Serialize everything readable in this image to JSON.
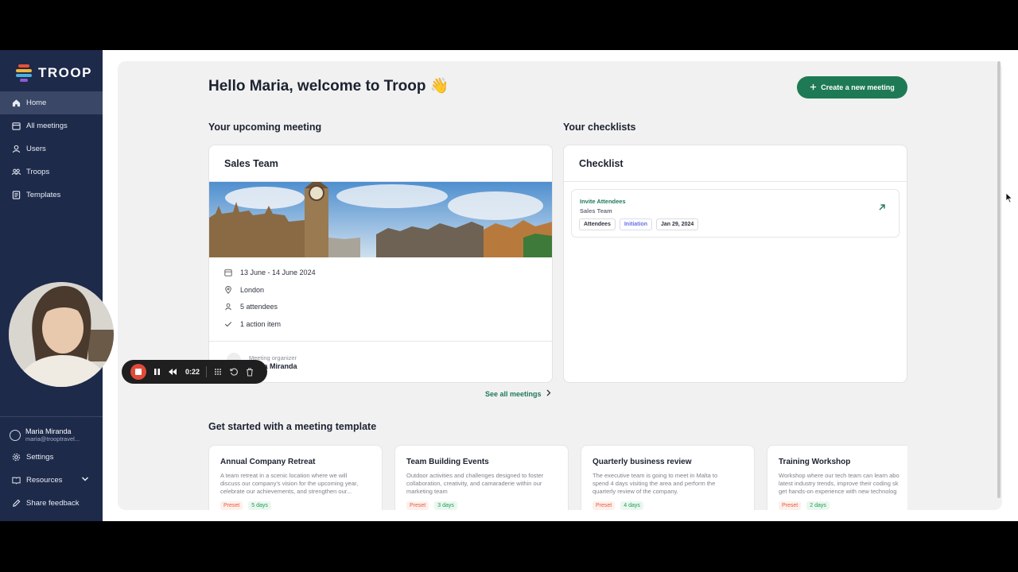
{
  "brand": {
    "name": "TROOP"
  },
  "sidebar": {
    "items": [
      {
        "label": "Home",
        "icon": "home-icon",
        "active": true
      },
      {
        "label": "All meetings",
        "icon": "calendar-icon"
      },
      {
        "label": "Users",
        "icon": "user-icon"
      },
      {
        "label": "Troops",
        "icon": "group-icon"
      },
      {
        "label": "Templates",
        "icon": "template-icon"
      }
    ],
    "user": {
      "name": "Maria Miranda",
      "email": "maria@trooptravel..."
    },
    "footer": [
      {
        "label": "Settings",
        "icon": "gear-icon"
      },
      {
        "label": "Resources",
        "icon": "book-icon"
      },
      {
        "label": "Share feedback",
        "icon": "pencil-icon"
      }
    ]
  },
  "header": {
    "greeting": "Hello Maria, welcome to Troop 👋",
    "create_button": "Create a new meeting"
  },
  "upcoming": {
    "section_title": "Your upcoming meeting",
    "title": "Sales Team",
    "dates": "13 June - 14 June 2024",
    "location": "London",
    "attendees": "5 attendees",
    "action_items": "1 action item",
    "organizer_label": "Meeting organizer",
    "organizer_name": "Maria Miranda",
    "see_all": "See all meetings"
  },
  "checklists": {
    "section_title": "Your checklists",
    "title": "Checklist",
    "item": {
      "title": "Invite Attendees",
      "subtitle": "Sales Team",
      "tags": [
        "Attendees",
        "Initiation",
        "Jan 29, 2024"
      ]
    }
  },
  "templates": {
    "section_title": "Get started with a meeting template",
    "items": [
      {
        "title": "Annual Company Retreat",
        "desc": [
          "A team retreat in a scenic location where we will",
          "discuss our company's vision for the upcoming year,",
          "celebrate our achievements, and strengthen our..."
        ],
        "preset": "Preset",
        "days": "5 days"
      },
      {
        "title": "Team Building Events",
        "desc": [
          "Outdoor activities and challenges designed to foster",
          "collaboration, creativity, and camaraderie within our",
          "marketing team"
        ],
        "preset": "Preset",
        "days": "3 days"
      },
      {
        "title": "Quarterly business review",
        "desc": [
          "The executive team is going to meet in Malta to",
          "spend 4 days visiting the area and perform the",
          "quarterly review of the company."
        ],
        "preset": "Preset",
        "days": "4 days"
      },
      {
        "title": "Training Workshop",
        "desc": [
          "Workshop where our tech team can learn abo",
          "latest industry trends, improve their coding sk",
          "get hands-on experience with new technolog"
        ],
        "preset": "Preset",
        "days": "2 days"
      }
    ]
  },
  "recorder": {
    "time": "0:22"
  },
  "colors": {
    "sidebar": "#1e2a4a",
    "accent": "#1e7a55",
    "record": "#e04a3a"
  }
}
